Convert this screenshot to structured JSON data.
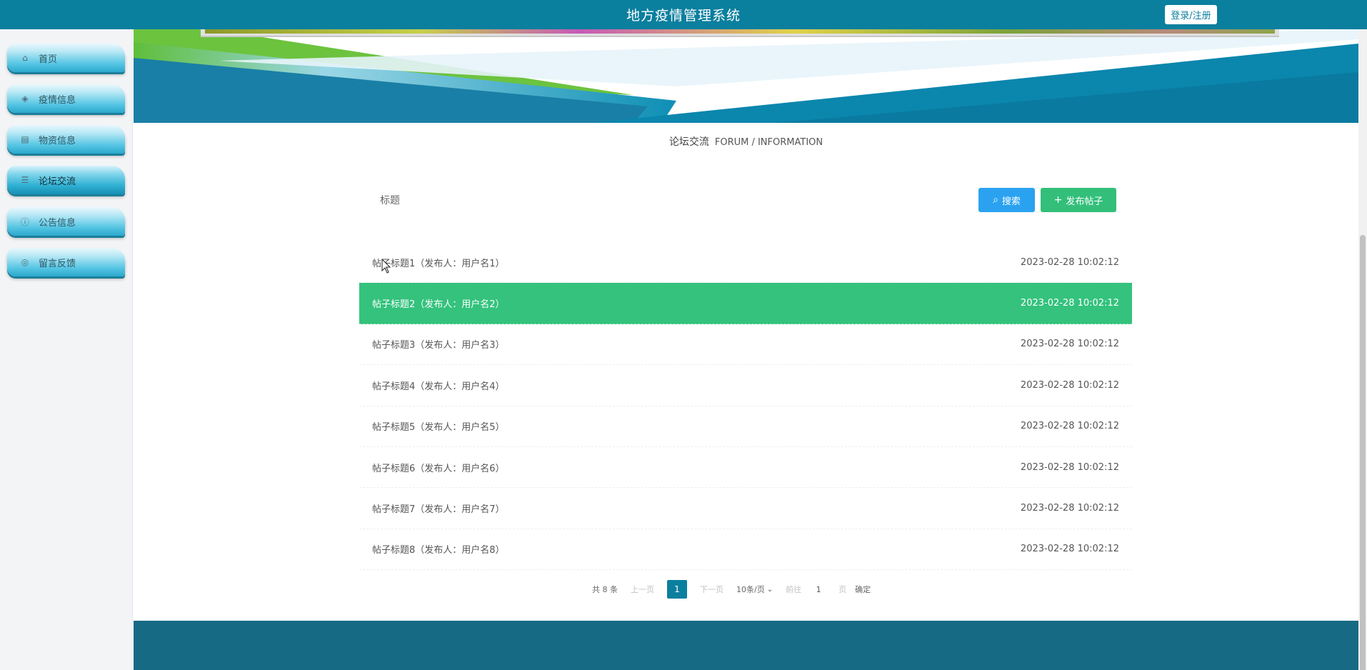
{
  "header": {
    "title": "地方疫情管理系统",
    "login_label": "登录/注册"
  },
  "sidebar": {
    "items": [
      {
        "label": "首页",
        "icon": "home-icon",
        "glyph": "⌂"
      },
      {
        "label": "疫情信息",
        "icon": "layers-icon",
        "glyph": "◈"
      },
      {
        "label": "物资信息",
        "icon": "printer-icon",
        "glyph": "▤"
      },
      {
        "label": "论坛交流",
        "icon": "sliders-icon",
        "glyph": "☰"
      },
      {
        "label": "公告信息",
        "icon": "info-circle-icon",
        "glyph": "ⓘ"
      },
      {
        "label": "留言反馈",
        "icon": "message-icon",
        "glyph": "◎"
      }
    ],
    "active_index": 3
  },
  "section": {
    "title_cn": "论坛交流",
    "title_en": "FORUM / INFORMATION"
  },
  "search": {
    "label": "标题",
    "search_button": "搜索",
    "post_button": "发布帖子"
  },
  "posts": [
    {
      "title": "帖子标题1（发布人：用户名1）",
      "date": "2023-02-28 10:02:12"
    },
    {
      "title": "帖子标题2（发布人：用户名2）",
      "date": "2023-02-28 10:02:12"
    },
    {
      "title": "帖子标题3（发布人：用户名3）",
      "date": "2023-02-28 10:02:12"
    },
    {
      "title": "帖子标题4（发布人：用户名4）",
      "date": "2023-02-28 10:02:12"
    },
    {
      "title": "帖子标题5（发布人：用户名5）",
      "date": "2023-02-28 10:02:12"
    },
    {
      "title": "帖子标题6（发布人：用户名6）",
      "date": "2023-02-28 10:02:12"
    },
    {
      "title": "帖子标题7（发布人：用户名7）",
      "date": "2023-02-28 10:02:12"
    },
    {
      "title": "帖子标题8（发布人：用户名8）",
      "date": "2023-02-28 10:02:12"
    }
  ],
  "active_post_index": 1,
  "pagination": {
    "total": "共 8 条",
    "prev": "上一页",
    "current_page": "1",
    "next": "下一页",
    "page_size": "10条/页",
    "goto_label": "前往",
    "goto_value": "1",
    "page_unit": "页",
    "confirm": "确定"
  },
  "colors": {
    "header_bg": "#0b7f9e",
    "active_row": "#34c27d",
    "search_btn": "#2aa2f0",
    "post_btn": "#33bf7a",
    "footer_bg": "#176a84"
  }
}
